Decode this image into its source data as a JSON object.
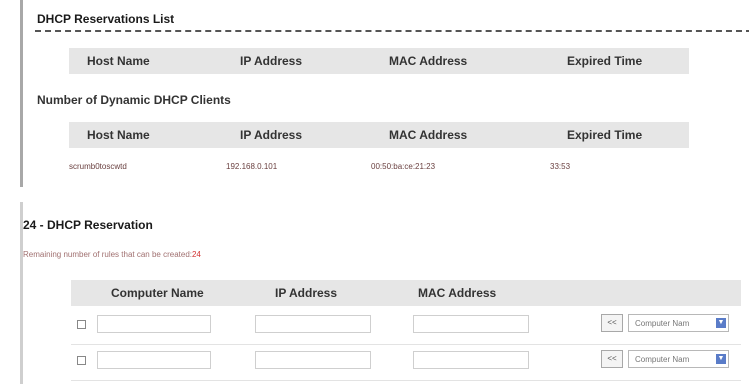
{
  "reservations_list": {
    "title": "DHCP Reservations List",
    "columns": [
      "Host Name",
      "IP Address",
      "MAC Address",
      "Expired Time"
    ]
  },
  "dynamic_clients": {
    "title": "Number of Dynamic DHCP Clients",
    "columns": [
      "Host Name",
      "IP Address",
      "MAC Address",
      "Expired Time"
    ],
    "rows": [
      {
        "host": "scrumb0toscwtd",
        "ip": "192.168.0.101",
        "mac": "00:50:ba:ce:21:23",
        "expires": "33:53"
      }
    ]
  },
  "reservation": {
    "title": "24 - DHCP Reservation",
    "remaining_label": "Remaining number of rules that can be created:",
    "remaining_count": "24",
    "columns": [
      "Computer Name",
      "IP Address",
      "MAC Address"
    ],
    "rows": [
      {
        "computer_name": "",
        "ip": "",
        "mac": "",
        "copy_label": "<<",
        "select_value": "Computer Nam"
      },
      {
        "computer_name": "",
        "ip": "",
        "mac": "",
        "copy_label": "<<",
        "select_value": "Computer Nam"
      }
    ]
  }
}
